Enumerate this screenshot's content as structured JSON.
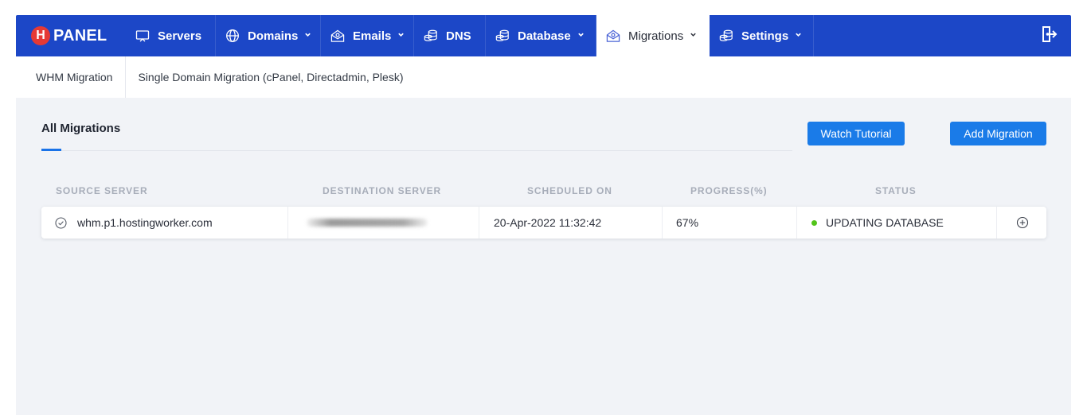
{
  "logo": {
    "badge": "H",
    "text": "PANEL"
  },
  "nav": {
    "items": [
      {
        "label": "Servers",
        "icon": "monitor-icon",
        "chevron": false,
        "active": false
      },
      {
        "label": "Domains",
        "icon": "globe-icon",
        "chevron": true,
        "active": false
      },
      {
        "label": "Emails",
        "icon": "envelope-icon",
        "chevron": true,
        "active": false
      },
      {
        "label": "DNS",
        "icon": "database-stack-icon",
        "chevron": false,
        "active": false
      },
      {
        "label": "Database",
        "icon": "database-stack-icon",
        "chevron": true,
        "active": false
      },
      {
        "label": "Migrations",
        "icon": "envelope-icon",
        "chevron": true,
        "active": true
      },
      {
        "label": "Settings",
        "icon": "database-stack-icon",
        "chevron": true,
        "active": false
      }
    ],
    "logout_icon": "logout-icon"
  },
  "subnav": {
    "items": [
      "WHM Migration",
      "Single Domain Migration (cPanel, Directadmin, Plesk)"
    ]
  },
  "main": {
    "tab_label": "All Migrations",
    "watch_tutorial_label": "Watch Tutorial",
    "add_migration_label": "Add Migration",
    "columns": [
      "SOURCE SERVER",
      "DESTINATION SERVER",
      "SCHEDULED ON",
      "PROGRESS(%)",
      "STATUS"
    ],
    "rows": [
      {
        "source": "whm.p1.hostingworker.com",
        "destination": "",
        "scheduled": "20-Apr-2022 11:32:42",
        "progress": "67%",
        "status": "UPDATING DATABASE"
      }
    ]
  },
  "colors": {
    "nav_bg": "#1c47c7",
    "accent": "#1a7be8",
    "status_dot": "#52c41a",
    "logo_badge": "#e53935"
  }
}
